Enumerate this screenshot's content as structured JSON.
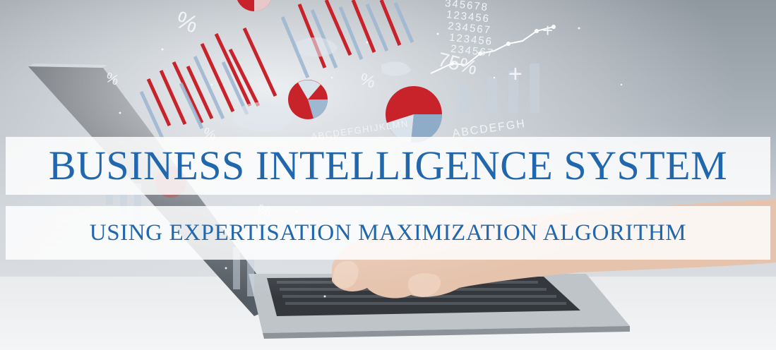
{
  "banner": {
    "title": "BUSINESS INTELLIGENCE SYSTEM",
    "subtitle": "USING EXPERTISATION MAXIMIZATION ALGORITHM"
  },
  "overlay_text": {
    "percent_top": "%",
    "percent_left": "%",
    "percent_mid": "%",
    "percent_lower": "%",
    "percent_bottom": "%",
    "seventy_five": "75%",
    "plus_sign": "+",
    "plus_sign_2": "+",
    "number_rows": [
      "345678",
      "123456",
      "234567",
      "123456",
      "234567"
    ],
    "letters_row": "ABCDEFGHIJKLMN",
    "hex_row": "ABCDEFGH"
  },
  "colors": {
    "title_blue": "#2167ad",
    "chart_red": "#c8222b",
    "chart_blue": "#9fb8d2",
    "banner_white": "rgba(255,255,255,0.84)"
  }
}
